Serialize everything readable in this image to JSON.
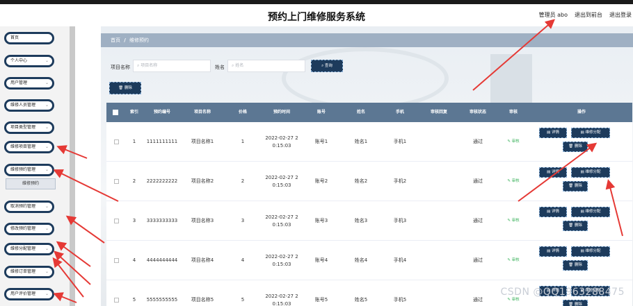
{
  "app": {
    "title": "预约上门维修服务系统",
    "user": "管理员 abo",
    "frontend_link": "退出到前台",
    "logout_link": "退出登录"
  },
  "sidebar": {
    "items": [
      {
        "label": "首页",
        "chevron": false
      },
      {
        "label": "个人中心",
        "chevron": true
      },
      {
        "label": "用户管理",
        "chevron": true
      },
      {
        "label": "维修人员管理",
        "chevron": true
      },
      {
        "label": "项目类型管理",
        "chevron": true
      },
      {
        "label": "维修项目管理",
        "chevron": true
      },
      {
        "label": "维修预约管理",
        "chevron": true
      },
      {
        "label": "取消预约管理",
        "chevron": true
      },
      {
        "label": "修改预约管理",
        "chevron": true
      },
      {
        "label": "维修分配管理",
        "chevron": true
      },
      {
        "label": "维修订单管理",
        "chevron": true
      },
      {
        "label": "用户评价管理",
        "chevron": true
      }
    ],
    "submenu_active": "维修预约"
  },
  "breadcrumb": {
    "home": "首页",
    "separator": "/",
    "current": "维修预约"
  },
  "search": {
    "project_label": "项目名称",
    "project_placeholder": "项目名称",
    "name_label": "姓名",
    "name_placeholder": "姓名",
    "query_button": "查询",
    "delete_button": "删除"
  },
  "table": {
    "headers": [
      "索引",
      "预约编号",
      "项目名称",
      "价格",
      "预约时间",
      "账号",
      "姓名",
      "手机",
      "审核回复",
      "审核状态",
      "审核",
      "操作"
    ],
    "rows": [
      {
        "index": "1",
        "code": "1111111111",
        "project": "项目名称1",
        "price": "1",
        "time": "2022-02-27 2 0:15:03",
        "account": "账号1",
        "name": "姓名1",
        "phone": "手机1",
        "reply": "",
        "status": "通过",
        "audit": "审核"
      },
      {
        "index": "2",
        "code": "2222222222",
        "project": "项目名称2",
        "price": "2",
        "time": "2022-02-27 2 0:15:03",
        "account": "账号2",
        "name": "姓名2",
        "phone": "手机2",
        "reply": "",
        "status": "通过",
        "audit": "审核"
      },
      {
        "index": "3",
        "code": "3333333333",
        "project": "项目名称3",
        "price": "3",
        "time": "2022-02-27 2 0:15:03",
        "account": "账号3",
        "name": "姓名3",
        "phone": "手机3",
        "reply": "",
        "status": "通过",
        "audit": "审核"
      },
      {
        "index": "4",
        "code": "4444444444",
        "project": "项目名称4",
        "price": "4",
        "time": "2022-02-27 2 0:15:03",
        "account": "账号4",
        "name": "姓名4",
        "phone": "手机4",
        "reply": "",
        "status": "通过",
        "audit": "审核"
      },
      {
        "index": "5",
        "code": "5555555555",
        "project": "项目名称5",
        "price": "5",
        "time": "2022-02-27 2 0:15:03",
        "account": "账号5",
        "name": "姓名5",
        "phone": "手机5",
        "reply": "",
        "status": "通过",
        "audit": "审核"
      }
    ],
    "ops": {
      "detail": "详情",
      "assign": "维修分配",
      "delete": "删除"
    }
  },
  "watermark": "CSDN @QQ1963288475",
  "colors": {
    "accent": "#1d3b5c",
    "header_row": "#5c7793",
    "annotation_arrow": "#e53935",
    "audit_link": "#3bb25c"
  }
}
